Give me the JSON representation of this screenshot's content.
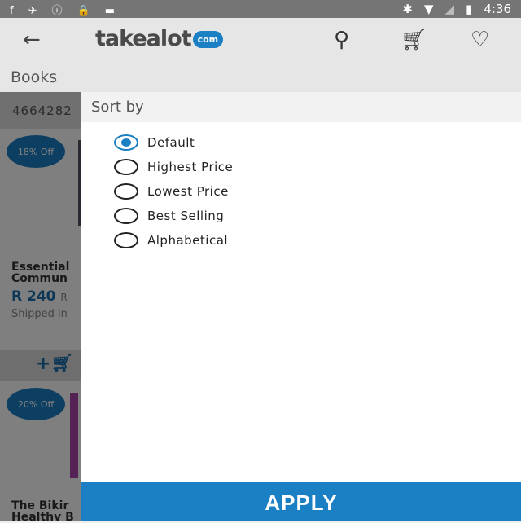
{
  "status": {
    "left_icons": [
      "facebook-icon",
      "satellite-icon",
      "info-icon",
      "lock-icon",
      "android-icon"
    ],
    "time": "4:36"
  },
  "appbar": {
    "logo": "takealot",
    "logo_suffix": "com",
    "category": "Books"
  },
  "background": {
    "count": "4664282",
    "cards": [
      {
        "badge": "18% Off",
        "title_line1": "Essential",
        "title_line2": "Commun",
        "price": "R 240",
        "old_price": "R",
        "shipping": "Shipped in"
      },
      {
        "badge": "20% Off",
        "title_line1": "The Bikir",
        "title_line2": "Healthy B"
      }
    ]
  },
  "sort": {
    "title": "Sort by",
    "options": [
      {
        "label": "Default",
        "selected": true
      },
      {
        "label": "Highest Price",
        "selected": false
      },
      {
        "label": "Lowest Price",
        "selected": false
      },
      {
        "label": "Best Selling",
        "selected": false
      },
      {
        "label": "Alphabetical",
        "selected": false
      }
    ],
    "apply_label": "APPLY"
  },
  "colors": {
    "accent": "#1b7fc4"
  }
}
